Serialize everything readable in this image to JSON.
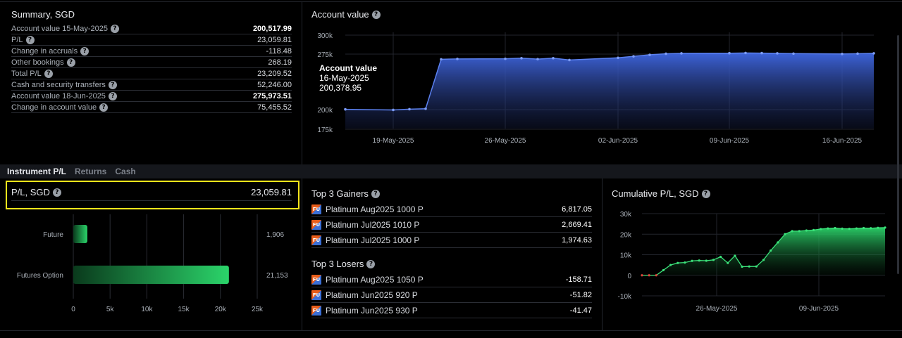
{
  "summary": {
    "title": "Summary, SGD",
    "rows": [
      {
        "label": "Account value 15-May-2025",
        "value": "200,517.99",
        "bold": true
      },
      {
        "label": "P/L",
        "value": "23,059.81",
        "bold": false
      },
      {
        "label": "Change in accruals",
        "value": "-118.48",
        "bold": false
      },
      {
        "label": "Other bookings",
        "value": "268.19",
        "bold": false
      },
      {
        "label": "Total P/L",
        "value": "23,209.52",
        "bold": false
      },
      {
        "label": "Cash and security transfers",
        "value": "52,246.00",
        "bold": false
      },
      {
        "label": "Account value 18-Jun-2025",
        "value": "275,973.51",
        "bold": true
      },
      {
        "label": "Change in account value",
        "value": "75,455.52",
        "bold": false
      }
    ]
  },
  "account_chart": {
    "title": "Account value",
    "tooltip": {
      "label": "Account value",
      "date": "16-May-2025",
      "value": "200,378.95"
    }
  },
  "tabs": [
    {
      "label": "Instrument P/L",
      "active": true
    },
    {
      "label": "Returns",
      "active": false
    },
    {
      "label": "Cash",
      "active": false
    }
  ],
  "pl_total": {
    "label": "P/L, SGD",
    "value": "23,059.81"
  },
  "gainers": {
    "title": "Top 3 Gainers",
    "items": [
      {
        "name": "Platinum Aug2025 1000 P",
        "value": "6,817.05"
      },
      {
        "name": "Platinum Jul2025 1010 P",
        "value": "2,669.41"
      },
      {
        "name": "Platinum Jul2025 1000 P",
        "value": "1,974.63"
      }
    ]
  },
  "losers": {
    "title": "Top 3 Losers",
    "items": [
      {
        "name": "Platinum Aug2025 1050 P",
        "value": "-158.71"
      },
      {
        "name": "Platinum Jun2025 920 P",
        "value": "-51.82"
      },
      {
        "name": "Platinum Jun2025 930 P",
        "value": "-41.47"
      }
    ]
  },
  "cumulative": {
    "title": "Cumulative P/L, SGD"
  },
  "fu_icon_text": "FU",
  "colors": {
    "accent_blue": "#3d63d8",
    "accent_green": "#2bd46a",
    "highlight": "#f5e51b",
    "loss_red": "#e0453a"
  },
  "chart_data": [
    {
      "type": "area",
      "title": "Account value",
      "yticks": [
        "300k",
        "275k",
        "200k",
        "175k"
      ],
      "xticks": [
        "19-May-2025",
        "26-May-2025",
        "02-Jun-2025",
        "09-Jun-2025",
        "16-Jun-2025"
      ],
      "ylim": [
        175000,
        300000
      ],
      "y_axis_note": "broken axis between 200k and 275k",
      "x": [
        "16-May-2025",
        "19-May-2025",
        "20-May-2025",
        "21-May-2025",
        "22-May-2025",
        "23-May-2025",
        "26-May-2025",
        "27-May-2025",
        "28-May-2025",
        "29-May-2025",
        "30-May-2025",
        "02-Jun-2025",
        "03-Jun-2025",
        "04-Jun-2025",
        "05-Jun-2025",
        "06-Jun-2025",
        "09-Jun-2025",
        "10-Jun-2025",
        "11-Jun-2025",
        "12-Jun-2025",
        "13-Jun-2025",
        "16-Jun-2025",
        "17-Jun-2025",
        "18-Jun-2025"
      ],
      "values": [
        200379,
        199600,
        200600,
        201200,
        268000,
        268500,
        268700,
        269500,
        268200,
        269500,
        267000,
        270000,
        272000,
        274000,
        275500,
        276000,
        276200,
        276500,
        276300,
        276000,
        275700,
        275200,
        275600,
        276000
      ]
    },
    {
      "type": "bar",
      "orientation": "horizontal",
      "categories": [
        "Future",
        "Futures Option"
      ],
      "values": [
        1906,
        21153
      ],
      "value_labels": [
        "1,906",
        "21,153"
      ],
      "xticks": [
        "0",
        "5k",
        "10k",
        "15k",
        "20k",
        "25k"
      ],
      "xlim": [
        0,
        25000
      ]
    },
    {
      "type": "area",
      "title": "Cumulative P/L, SGD",
      "yticks": [
        "30k",
        "20k",
        "10k",
        "0",
        "-10k"
      ],
      "xticks": [
        "26-May-2025",
        "09-Jun-2025"
      ],
      "ylim": [
        -10000,
        30000
      ],
      "values": [
        0,
        0,
        0,
        2500,
        5000,
        6000,
        6200,
        7000,
        7200,
        7100,
        7500,
        9000,
        6000,
        9500,
        4200,
        4300,
        4300,
        7500,
        12000,
        16000,
        20000,
        21500,
        21500,
        21800,
        22000,
        22500,
        22800,
        23000,
        22700,
        22600,
        22800,
        23000,
        22900,
        23100,
        23200
      ]
    }
  ]
}
